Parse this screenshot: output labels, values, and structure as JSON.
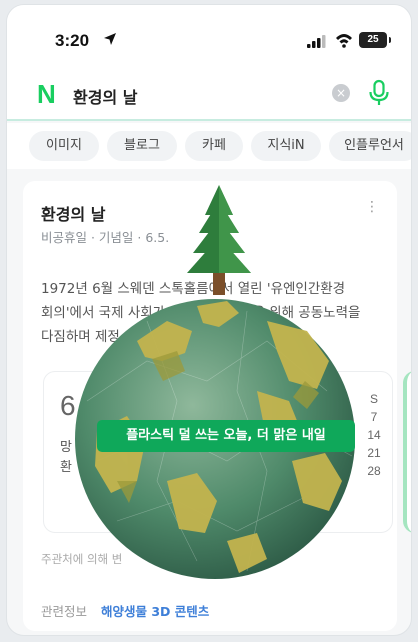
{
  "status_bar": {
    "time": "3:20",
    "battery": "25"
  },
  "search": {
    "logo": "N",
    "query": "환경의 날",
    "clear_icon": "×"
  },
  "tabs": [
    "이미지",
    "블로그",
    "카페",
    "지식iN",
    "인플루언서"
  ],
  "card": {
    "title": "환경의 날",
    "meta": "비공휴일 · 기념일 · 6.5.",
    "more_icon": "⋮",
    "desc_line1": "1972년 6월 스웨덴 스톡홀름에서 열린 '유엔인간환경",
    "desc_line2": "회의'에서 국제 사회가 지구 환경 보전을 위해 공동노력을",
    "desc_line3": "다짐하며 제정",
    "calendar": {
      "date_partial": "6",
      "text1": "망",
      "text2": "환",
      "day_header": "S",
      "days": [
        "7",
        "14",
        "21",
        "28"
      ]
    },
    "source": "주관처에 의해 변",
    "related_label": "관련정보",
    "related_link": "해양생물 3D 콘텐츠"
  },
  "overlay": {
    "banner": "플라스틱 덜 쓰는 오늘, 더 맑은 내일"
  },
  "colors": {
    "naver_green": "#19ce60",
    "banner_green": "#0fa85a",
    "link_blue": "#3e7fd8"
  }
}
